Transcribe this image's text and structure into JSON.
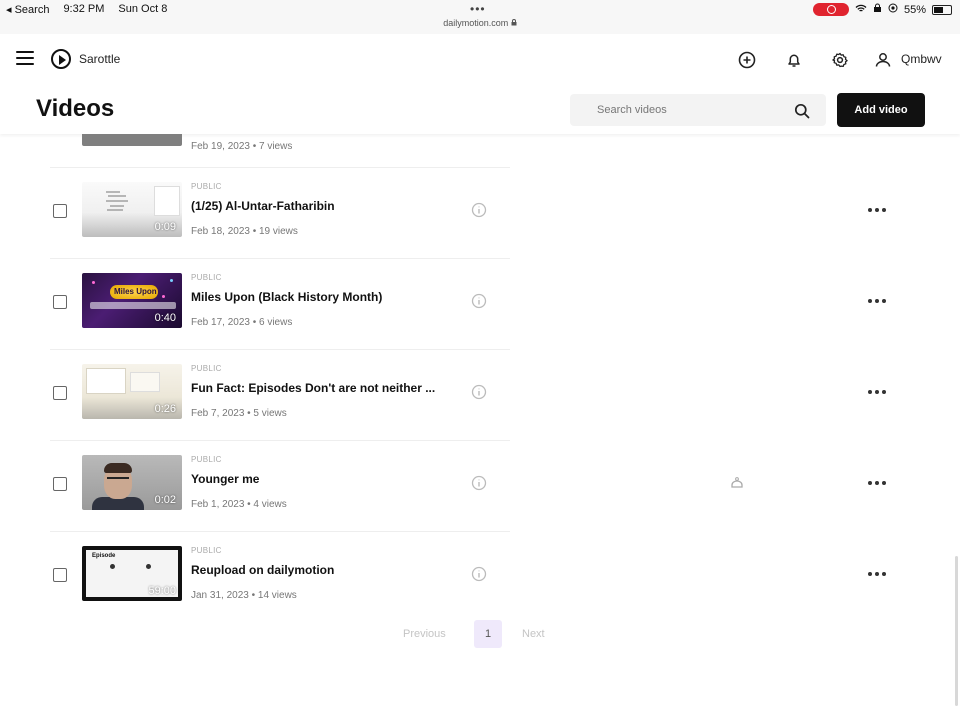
{
  "status_bar": {
    "back_label": "◂ Search",
    "time": "9:32 PM",
    "date": "Sun Oct 8",
    "dots": "•••",
    "url": "dailymotion.com",
    "battery_text": "55%",
    "battery_level": 0.55,
    "record_color": "#e0242f"
  },
  "appbar": {
    "channel_name": "Sarottle",
    "user_name": "Qmbwv",
    "icons": [
      "menu-icon",
      "play-icon",
      "upload-icon",
      "bell-icon",
      "settings-icon",
      "user-icon"
    ]
  },
  "header": {
    "title": "Videos",
    "search_placeholder": "Search videos",
    "add_button_label": "Add video"
  },
  "partial_row": {
    "meta": "Feb 19, 2023 • 7 views"
  },
  "videos": [
    {
      "visibility": "PUBLIC",
      "title": "(1/25) Al-Untar-Fatharibin",
      "meta": "Feb 18, 2023 • 19 views",
      "duration": "0:09"
    },
    {
      "visibility": "PUBLIC",
      "title": "Miles Upon (Black History Month)",
      "meta": "Feb 17, 2023 • 6 views",
      "duration": "0:40"
    },
    {
      "visibility": "PUBLIC",
      "title": "Fun Fact: Episodes Don't are not neither ...",
      "meta": "Feb 7, 2023 • 5 views",
      "duration": "0:26"
    },
    {
      "visibility": "PUBLIC",
      "title": "Younger me",
      "meta": "Feb 1, 2023 • 4 views",
      "duration": "0:02"
    },
    {
      "visibility": "PUBLIC",
      "title": "Reupload on dailymotion",
      "meta": "Jan 31, 2023 • 14 views",
      "duration": "59:00"
    }
  ],
  "thumb_texts": {
    "miles_banner": "Miles Upon",
    "episode_header": "Episode"
  },
  "pagination": {
    "previous_label": "Previous",
    "current_page": "1",
    "next_label": "Next"
  },
  "colors": {
    "accent_button": "#111111",
    "page_highlight": "#efe9fb"
  }
}
